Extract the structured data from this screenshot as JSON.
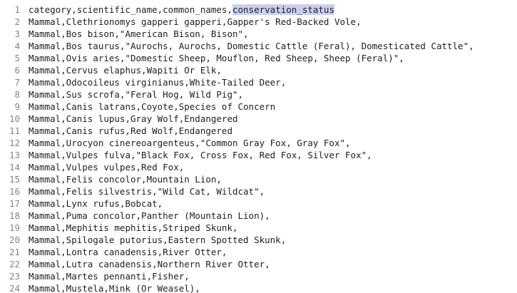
{
  "editor": {
    "header_line": {
      "number": "1",
      "before": "category,scientific_name,common_names,",
      "selected": "conservation_status"
    },
    "lines": [
      {
        "number": "2",
        "text": "Mammal,Clethrionomys gapperi gapperi,Gapper's Red-Backed Vole,"
      },
      {
        "number": "3",
        "text": "Mammal,Bos bison,\"American Bison, Bison\","
      },
      {
        "number": "4",
        "text": "Mammal,Bos taurus,\"Aurochs, Aurochs, Domestic Cattle (Feral), Domesticated Cattle\","
      },
      {
        "number": "5",
        "text": "Mammal,Ovis aries,\"Domestic Sheep, Mouflon, Red Sheep, Sheep (Feral)\","
      },
      {
        "number": "6",
        "text": "Mammal,Cervus elaphus,Wapiti Or Elk,"
      },
      {
        "number": "7",
        "text": "Mammal,Odocoileus virginianus,White-Tailed Deer,"
      },
      {
        "number": "8",
        "text": "Mammal,Sus scrofa,\"Feral Hog, Wild Pig\","
      },
      {
        "number": "9",
        "text": "Mammal,Canis latrans,Coyote,Species of Concern"
      },
      {
        "number": "10",
        "text": "Mammal,Canis lupus,Gray Wolf,Endangered"
      },
      {
        "number": "11",
        "text": "Mammal,Canis rufus,Red Wolf,Endangered"
      },
      {
        "number": "12",
        "text": "Mammal,Urocyon cinereoargenteus,\"Common Gray Fox, Gray Fox\","
      },
      {
        "number": "13",
        "text": "Mammal,Vulpes fulva,\"Black Fox, Cross Fox, Red Fox, Silver Fox\","
      },
      {
        "number": "14",
        "text": "Mammal,Vulpes vulpes,Red Fox,"
      },
      {
        "number": "15",
        "text": "Mammal,Felis concolor,Mountain Lion,"
      },
      {
        "number": "16",
        "text": "Mammal,Felis silvestris,\"Wild Cat, Wildcat\","
      },
      {
        "number": "17",
        "text": "Mammal,Lynx rufus,Bobcat,"
      },
      {
        "number": "18",
        "text": "Mammal,Puma concolor,Panther (Mountain Lion),"
      },
      {
        "number": "19",
        "text": "Mammal,Mephitis mephitis,Striped Skunk,"
      },
      {
        "number": "20",
        "text": "Mammal,Spilogale putorius,Eastern Spotted Skunk,"
      },
      {
        "number": "21",
        "text": "Mammal,Lontra canadensis,River Otter,"
      },
      {
        "number": "22",
        "text": "Mammal,Lutra canadensis,Northern River Otter,"
      },
      {
        "number": "23",
        "text": "Mammal,Martes pennanti,Fisher,"
      },
      {
        "number": "24",
        "text": "Mammal,Mustela,Mink (Or Weasel),"
      }
    ]
  }
}
